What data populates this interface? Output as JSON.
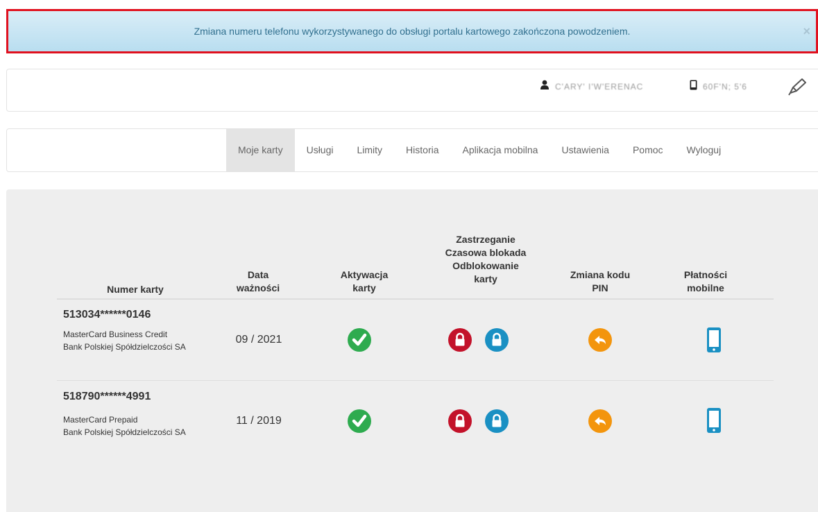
{
  "alert": {
    "message": "Zmiana numeru telefonu wykorzystywanego do obsługi portalu kartowego zakończona powodzeniem.",
    "close": "×"
  },
  "userbar": {
    "user_name": "C'ARY' I'W'ERENAC",
    "phone_number": "60F'N; 5'6"
  },
  "nav": {
    "items": [
      {
        "label": "Moje karty"
      },
      {
        "label": "Usługi"
      },
      {
        "label": "Limity"
      },
      {
        "label": "Historia"
      },
      {
        "label": "Aplikacja mobilna"
      },
      {
        "label": "Ustawienia"
      },
      {
        "label": "Pomoc"
      },
      {
        "label": "Wyloguj"
      }
    ],
    "active": "Moje karty"
  },
  "table": {
    "headers": {
      "card_number": "Numer karty",
      "expiry_1": "Data",
      "expiry_2": "ważności",
      "activation_1": "Aktywacja",
      "activation_2": "karty",
      "block_1": "Zastrzeganie",
      "block_2": "Czasowa blokada",
      "block_3": "Odblokowanie",
      "block_4": "karty",
      "pin_1": "Zmiana kodu",
      "pin_2": "PIN",
      "mobile_1": "Płatności",
      "mobile_2": "mobilne"
    },
    "rows": [
      {
        "number": "513034******0146",
        "type": "MasterCard Business Credit",
        "bank": "Bank Polskiej Spółdzielczości SA",
        "expiry": "09 / 2021"
      },
      {
        "number": "518790******4991",
        "type": "MasterCard Prepaid",
        "bank": "Bank Polskiej Spółdzielczości SA",
        "expiry": "11 / 2019"
      }
    ]
  },
  "colors": {
    "alert_border": "#e0101e",
    "activate_green": "#2eab4f",
    "block_red": "#c3122a",
    "unlock_blue": "#1a90c3",
    "pin_orange": "#f3950d",
    "mobile_blue": "#1a90c3"
  },
  "icons": {
    "user": "user-icon",
    "phone": "mobile-phone-icon",
    "edit": "pencil-edit-icon",
    "activate": "check-circle-icon",
    "block": "padlock-closed-icon",
    "unblock": "padlock-open-icon",
    "pin": "reply-arrow-icon",
    "mobile_payments": "smartphone-icon"
  }
}
